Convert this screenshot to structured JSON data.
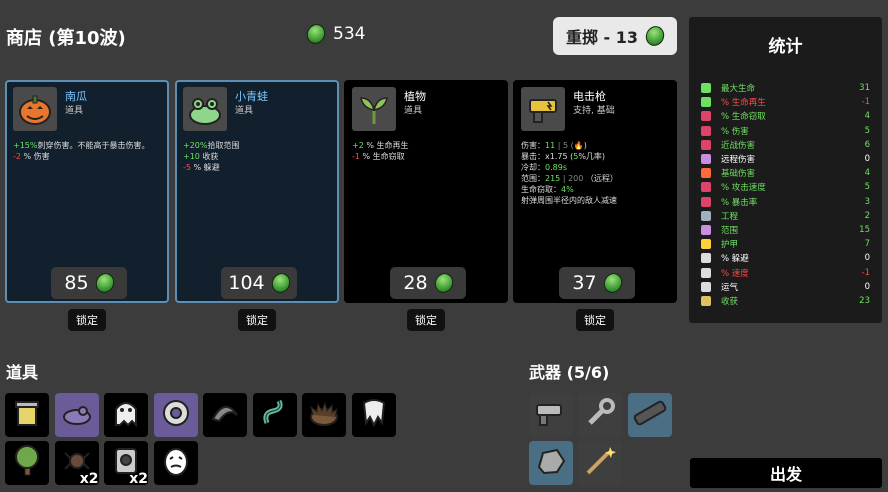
{
  "header": {
    "title": "商店 (第10波)",
    "materials": "534",
    "reroll_label": "重掷 - 13"
  },
  "cards": [
    {
      "name": "南瓜",
      "category": "道具",
      "price": "85",
      "lock_label": "锁定",
      "effects": [
        [
          [
            "+15%",
            "g"
          ],
          [
            "刺穿伤害。不能高于暴击伤害。",
            ""
          ]
        ],
        [
          [
            "-2",
            "r"
          ],
          [
            " % 伤害",
            ""
          ]
        ]
      ]
    },
    {
      "name": "小青蛙",
      "category": "道具",
      "price": "104",
      "lock_label": "锁定",
      "effects": [
        [
          [
            "+20%",
            "g"
          ],
          [
            "拾取范围",
            ""
          ]
        ],
        [
          [
            "+10",
            "g"
          ],
          [
            " 收获",
            ""
          ]
        ],
        [
          [
            "-5",
            "r"
          ],
          [
            " % 躲避",
            ""
          ]
        ]
      ]
    },
    {
      "name": "植物",
      "category": "道具",
      "price": "28",
      "lock_label": "锁定",
      "effects": [
        [
          [
            "+2",
            "g"
          ],
          [
            " % 生命再生",
            ""
          ]
        ],
        [
          [
            "-1",
            "r"
          ],
          [
            " % 生命窃取",
            ""
          ]
        ]
      ]
    },
    {
      "name": "电击枪",
      "category": "支持, 基础",
      "price": "37",
      "lock_label": "锁定",
      "effects": [
        [
          [
            "伤害：",
            ""
          ],
          [
            "11",
            "g"
          ],
          [
            " | 5 (",
            "gr"
          ],
          [
            "🔥",
            ""
          ],
          [
            ")",
            ""
          ]
        ],
        [
          [
            "暴击：",
            ""
          ],
          [
            "x1.75 (",
            ""
          ],
          [
            "5",
            "g"
          ],
          [
            "%几率)",
            ""
          ]
        ],
        [
          [
            "冷却：",
            ""
          ],
          [
            "0.89s",
            "g"
          ]
        ],
        [
          [
            "范围：",
            ""
          ],
          [
            "215",
            "g"
          ],
          [
            " | 200 ",
            "gr"
          ],
          [
            "（远程）",
            ""
          ]
        ],
        [
          [
            "生命窃取：",
            ""
          ],
          [
            "4%",
            "g"
          ]
        ],
        [
          [
            "射弹周围半径内的敌人减速",
            ""
          ]
        ]
      ]
    }
  ],
  "stats": {
    "title": "统计",
    "rows": [
      {
        "label": "最大生命",
        "value": "31",
        "color": "#6ee062",
        "icon": "heart-icon",
        "icon_color": "#6ee062"
      },
      {
        "label": "% 生命再生",
        "value": "-1",
        "color": "#ff4a4a",
        "icon": "regen-icon",
        "icon_color": "#6ee062"
      },
      {
        "label": "% 生命窃取",
        "value": "4",
        "color": "#6ee062",
        "icon": "fangs-icon",
        "icon_color": "#e0436a"
      },
      {
        "label": "% 伤害",
        "value": "5",
        "color": "#6ee062",
        "icon": "damage-icon",
        "icon_color": "#e0436a"
      },
      {
        "label": "近战伤害",
        "value": "6",
        "color": "#6ee062",
        "icon": "melee-icon",
        "icon_color": "#e0436a"
      },
      {
        "label": "远程伤害",
        "value": "0",
        "color": "#ffffff",
        "icon": "ranged-icon",
        "icon_color": "#c98ee0"
      },
      {
        "label": "基础伤害",
        "value": "4",
        "color": "#6ee062",
        "icon": "elemental-icon",
        "icon_color": "#ff6a3a"
      },
      {
        "label": "% 攻击速度",
        "value": "5",
        "color": "#6ee062",
        "icon": "attack-speed-icon",
        "icon_color": "#e0436a"
      },
      {
        "label": "% 暴击率",
        "value": "3",
        "color": "#6ee062",
        "icon": "crit-icon",
        "icon_color": "#e0436a"
      },
      {
        "label": "工程",
        "value": "2",
        "color": "#6ee062",
        "icon": "engineering-icon",
        "icon_color": "#9fb0c0"
      },
      {
        "label": "范围",
        "value": "15",
        "color": "#6ee062",
        "icon": "range-icon",
        "icon_color": "#c98ee0"
      },
      {
        "label": "护甲",
        "value": "7",
        "color": "#6ee062",
        "icon": "armor-icon",
        "icon_color": "#ffd23a"
      },
      {
        "label": "% 躲避",
        "value": "0",
        "color": "#ffffff",
        "icon": "dodge-icon",
        "icon_color": "#dddddd"
      },
      {
        "label": "% 速度",
        "value": "-1",
        "color": "#ff4a4a",
        "icon": "speed-icon",
        "icon_color": "#dddddd"
      },
      {
        "label": "运气",
        "value": "0",
        "color": "#ffffff",
        "icon": "luck-icon",
        "icon_color": "#dddddd"
      },
      {
        "label": "收获",
        "value": "23",
        "color": "#6ee062",
        "icon": "harvest-icon",
        "icon_color": "#e0c060"
      }
    ]
  },
  "items": {
    "title": "道具",
    "slots": [
      {
        "icon": "bucket-icon",
        "bg": "black"
      },
      {
        "icon": "slug-icon",
        "bg": "purple"
      },
      {
        "icon": "ghost-icon",
        "bg": "black"
      },
      {
        "icon": "tape-icon",
        "bg": "purple"
      },
      {
        "icon": "scarf-icon",
        "bg": "black"
      },
      {
        "icon": "worm-icon",
        "bg": "black"
      },
      {
        "icon": "hedgehog-icon",
        "bg": "black"
      },
      {
        "icon": "tooth-icon",
        "bg": "black"
      },
      {
        "icon": "tree-icon",
        "bg": "black"
      },
      {
        "icon": "spider-icon",
        "bg": "black",
        "qty": "x2"
      },
      {
        "icon": "camera-icon",
        "bg": "black",
        "qty": "x2"
      },
      {
        "icon": "egg-icon",
        "bg": "black"
      }
    ]
  },
  "weapons": {
    "title": "武器 (5/6)",
    "slots": [
      {
        "icon": "taser-icon",
        "bg": "gray"
      },
      {
        "icon": "wrench-icon",
        "bg": "gray"
      },
      {
        "icon": "rocket-launcher-icon",
        "bg": "bluebg"
      },
      {
        "icon": "rock-icon",
        "bg": "bluebg"
      },
      {
        "icon": "wand-icon",
        "bg": "gray"
      }
    ]
  },
  "go_label": "出发"
}
